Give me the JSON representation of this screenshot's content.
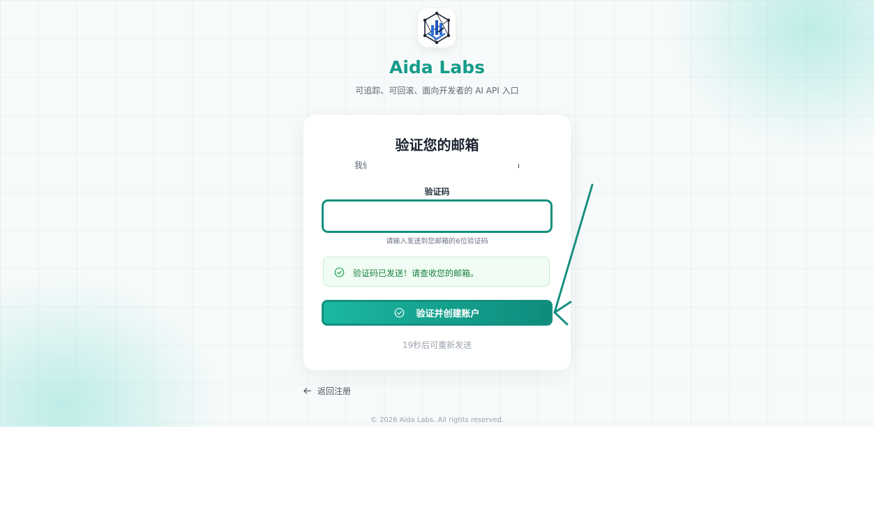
{
  "brand": {
    "name": "Aida Labs",
    "tagline": "可追踪、可回滚、面向开发者的 AI API 入口",
    "logo_icon": "shield-network-logo"
  },
  "card": {
    "title": "验证您的邮箱",
    "description": "我们",
    "field_label": "验证码",
    "input_value": "",
    "field_hint": "请输入发送到您邮箱的6位验证码",
    "success_message": "验证码已发送！请查收您的邮箱。",
    "submit_label": "验证并创建账户",
    "resend_text": "19秒后可重新发送"
  },
  "back_link": {
    "label": "返回注册"
  },
  "footer": {
    "copyright": "© 2026 Aida Labs. All rights reserved."
  },
  "colors": {
    "brand": "#149c8a",
    "accent": "#14907f",
    "success": "#17803d",
    "success_bg": "#f0fcf4"
  }
}
